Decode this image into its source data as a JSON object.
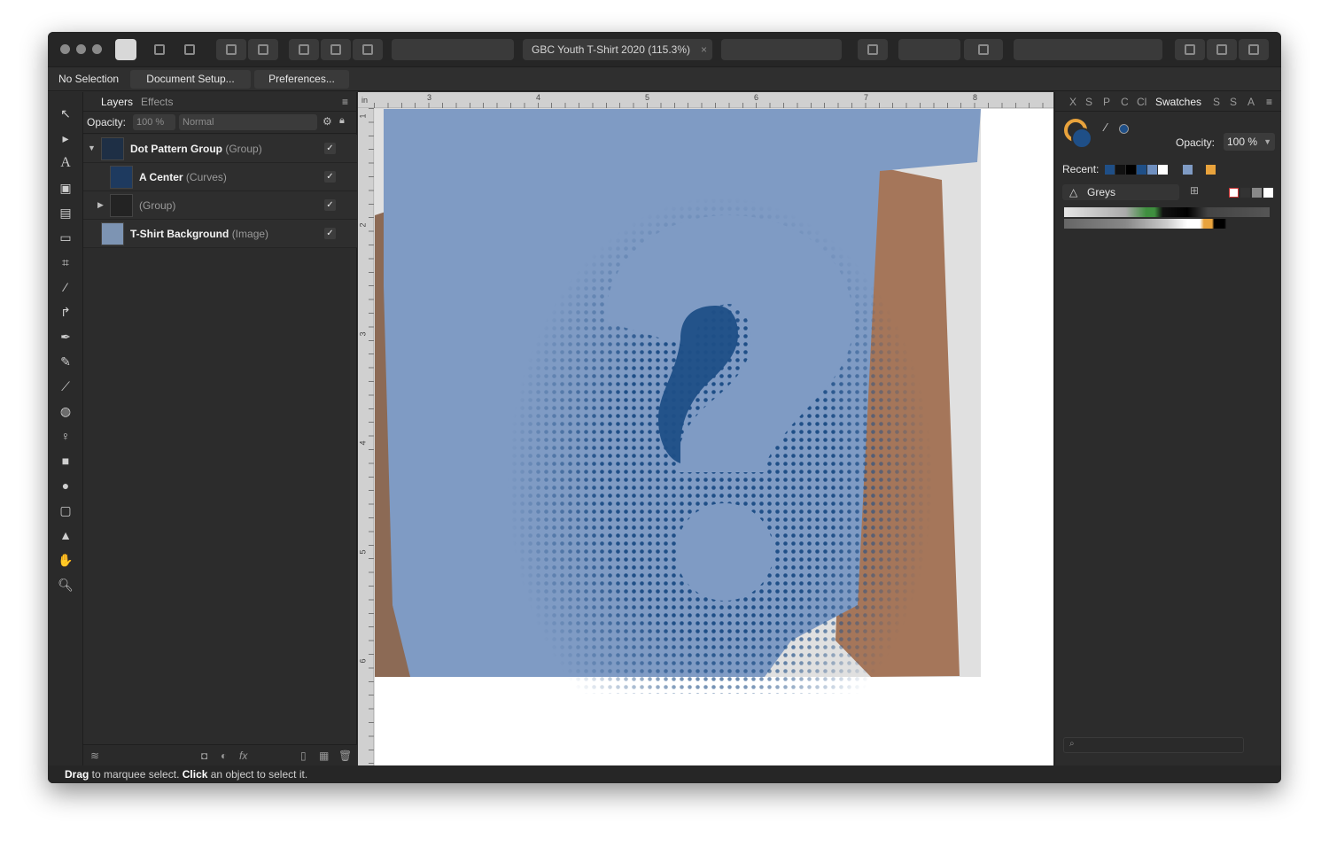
{
  "window": {
    "title": "GBC Youth T-Shirt 2020 (115.3%)",
    "close_mark": "×"
  },
  "context_bar": {
    "selection": "No Selection",
    "document_setup": "Document Setup...",
    "preferences": "Preferences..."
  },
  "layers_panel": {
    "tabs": [
      "Layers",
      "Effects"
    ],
    "opacity_label": "Opacity:",
    "opacity_value": "100 %",
    "blend_mode": "Normal",
    "layers": [
      {
        "name": "Dot Pattern Group",
        "kind": "(Group)",
        "visible": "✓"
      },
      {
        "name": "A Center",
        "kind": "(Curves)",
        "visible": "✓"
      },
      {
        "name": "",
        "kind": "(Group)",
        "visible": "✓"
      },
      {
        "name": "T-Shirt Background",
        "kind": "(Image)",
        "visible": "✓"
      }
    ]
  },
  "ruler": {
    "unit": "in",
    "top_ticks": [
      "3",
      "4",
      "5",
      "6",
      "7",
      "8"
    ],
    "left_ticks": [
      "1",
      "2",
      "3",
      "4",
      "5",
      "6"
    ]
  },
  "swatches_panel": {
    "tabs": [
      "X",
      "S",
      "P",
      "C",
      "Cl",
      "Swatches",
      "S",
      "S",
      "A"
    ],
    "opacity_label": "Opacity:",
    "opacity_value": "100 %",
    "recent_label": "Recent:",
    "palette_name": "Greys",
    "colors": {
      "primary": "#1f4f87",
      "accent": "#e9a33c"
    }
  },
  "status_bar": {
    "drag": "Drag",
    "drag_text": " to marquee select. ",
    "click": "Click",
    "click_text": " an object to select it."
  }
}
